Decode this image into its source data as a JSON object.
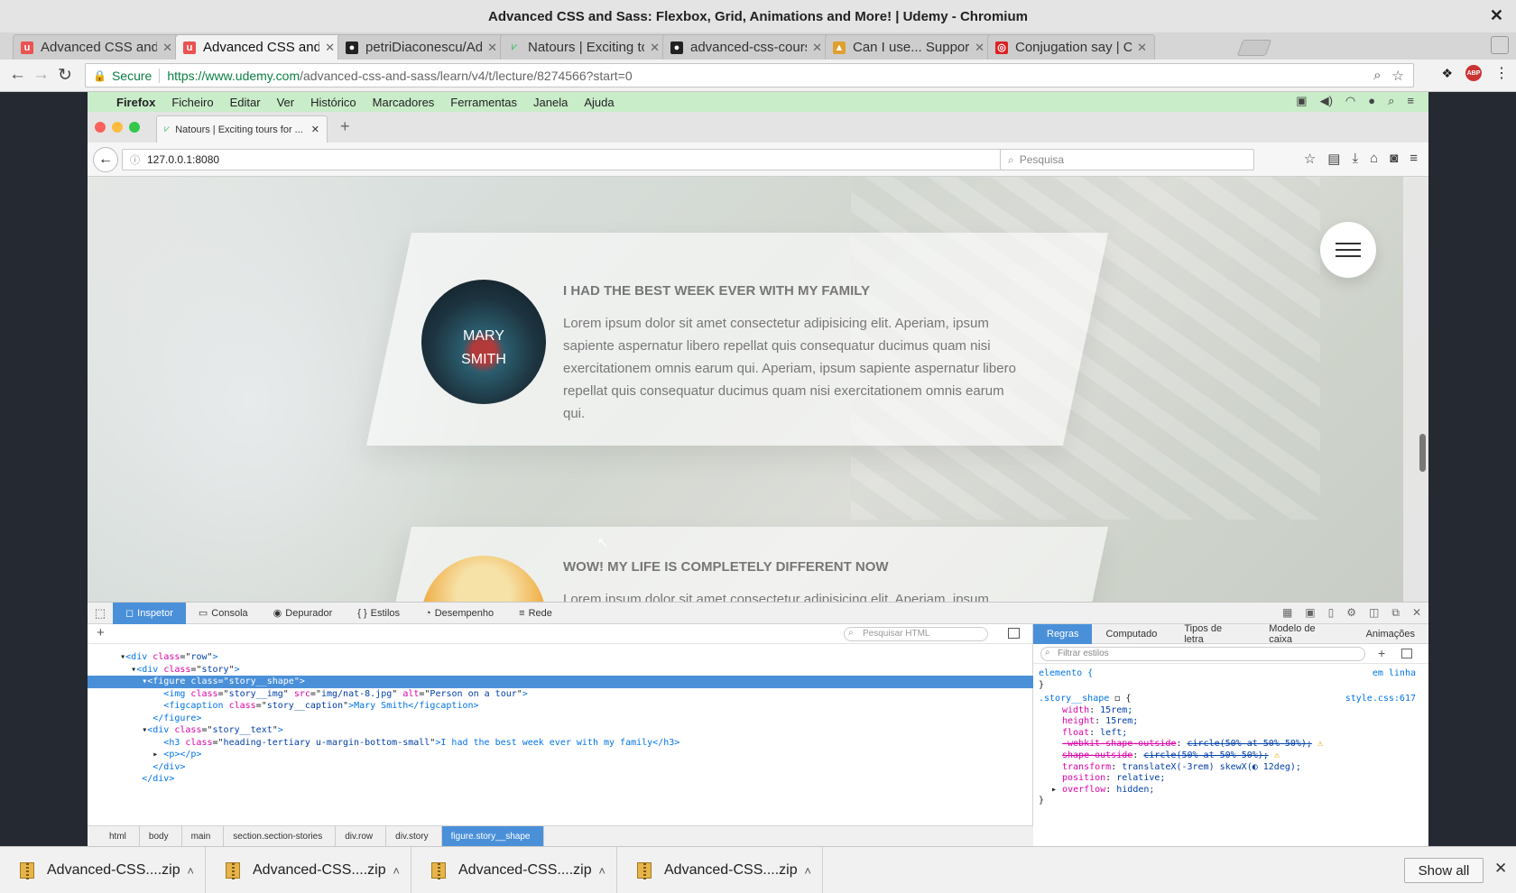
{
  "window": {
    "title": "Advanced CSS and Sass: Flexbox, Grid, Animations and More! | Udemy - Chromium"
  },
  "tabs": [
    {
      "title": "Advanced CSS and S",
      "favicon": "udemy",
      "active": false
    },
    {
      "title": "Advanced CSS and S",
      "favicon": "udemy",
      "active": true
    },
    {
      "title": "petriDiaconescu/Adv",
      "favicon": "github",
      "active": false
    },
    {
      "title": "Natours | Exciting to",
      "favicon": "natours",
      "active": false
    },
    {
      "title": "advanced-css-cours",
      "favicon": "github",
      "active": false
    },
    {
      "title": "Can I use... Support",
      "favicon": "caniuse",
      "active": false
    },
    {
      "title": "Conjugation say | C",
      "favicon": "reverso",
      "active": false
    }
  ],
  "omnibox": {
    "secure_label": "Secure",
    "url_host": "https://www.udemy.com",
    "url_path": "/advanced-css-and-sass/learn/v4/t/lecture/8274566?start=0"
  },
  "mac": {
    "menu": [
      "Firefox",
      "Ficheiro",
      "Editar",
      "Ver",
      "Histórico",
      "Marcadores",
      "Ferramentas",
      "Janela",
      "Ajuda"
    ]
  },
  "firefox": {
    "tab_title": "Natours | Exciting tours for ...",
    "url": "127.0.0.1:8080",
    "search_placeholder": "Pesquisa"
  },
  "stories": [
    {
      "caption_line1": "Mary",
      "caption_line2": "Smith",
      "title": "I had the best week ever with my family",
      "text": "Lorem ipsum dolor sit amet consectetur adipisicing elit. Aperiam, ipsum sapiente aspernatur libero repellat quis consequatur ducimus quam nisi exercitationem omnis earum qui. Aperiam, ipsum sapiente aspernatur libero repellat quis consequatur ducimus quam nisi exercitationem omnis earum qui."
    },
    {
      "title": "WOW! My life is completely different now",
      "text": "Lorem ipsum dolor sit amet consectetur adipisicing elit. Aperiam, ipsum"
    }
  ],
  "devtools": {
    "tabs": [
      "Inspetor",
      "Consola",
      "Depurador",
      "Estilos",
      "Desempenho",
      "Rede"
    ],
    "html_search_placeholder": "Pesquisar HTML",
    "markup": [
      {
        "indent": "  ▾",
        "tag": "div",
        "attrs": [
          [
            "class",
            "row"
          ]
        ],
        "after": ">"
      },
      {
        "indent": "    ▾",
        "tag": "div",
        "attrs": [
          [
            "class",
            "story"
          ]
        ],
        "after": ">"
      },
      {
        "indent": "      ▾",
        "tag": "figure",
        "attrs": [
          [
            "class",
            "story__shape"
          ]
        ],
        "after": ">",
        "selected": true
      },
      {
        "indent": "          ",
        "tag": "img",
        "attrs": [
          [
            "class",
            "story__img"
          ],
          [
            "src",
            "img/nat-8.jpg"
          ],
          [
            "alt",
            "Person on a tour"
          ]
        ],
        "after": ">"
      },
      {
        "indent": "          ",
        "tag": "figcaption",
        "attrs": [
          [
            "class",
            "story__caption"
          ]
        ],
        "after": ">Mary Smith</figcaption>"
      },
      {
        "indent": "        ",
        "raw": "</figure>"
      },
      {
        "indent": "      ▾",
        "tag": "div",
        "attrs": [
          [
            "class",
            "story__text"
          ]
        ],
        "after": ">"
      },
      {
        "indent": "          ",
        "tag": "h3",
        "attrs": [
          [
            "class",
            "heading-tertiary u-margin-bottom-small"
          ]
        ],
        "after": ">I had the best week ever with my family</h3>"
      },
      {
        "indent": "        ▸ ",
        "raw": "<p></p>"
      },
      {
        "indent": "        ",
        "raw": "</div>"
      },
      {
        "indent": "      ",
        "raw": "</div>"
      }
    ],
    "breadcrumbs": [
      "html",
      "body",
      "main",
      "section.section-stories",
      "div.row",
      "div.story",
      "figure.story__shape"
    ],
    "rules_tabs": [
      "Regras",
      "Computado",
      "Tipos de letra",
      "Modelo de caixa",
      "Animações"
    ],
    "filter_placeholder": "Filtrar estilos",
    "element_rule": {
      "selector": "elemento {",
      "source": "em linha"
    },
    "shape_rule": {
      "selector": ".story__shape",
      "source": "style.css:617",
      "declarations": [
        {
          "prop": "width",
          "value": "15rem;",
          "struck": false,
          "warn": false
        },
        {
          "prop": "height",
          "value": "15rem;",
          "struck": false,
          "warn": false
        },
        {
          "prop": "float",
          "value": "left;",
          "struck": false,
          "warn": false
        },
        {
          "prop": "-webkit-shape-outside",
          "value": "circle(50% at 50% 50%);",
          "struck": true,
          "warn": true
        },
        {
          "prop": "shape-outside",
          "value": "circle(50% at 50% 50%);",
          "struck": true,
          "warn": true
        },
        {
          "prop": "transform",
          "value": "translateX(-3rem) skewX(◐ 12deg);",
          "struck": false,
          "warn": false
        },
        {
          "prop": "position",
          "value": "relative;",
          "struck": false,
          "warn": false
        },
        {
          "prop": "overflow",
          "value": "hidden;",
          "struck": false,
          "warn": false
        }
      ]
    }
  },
  "downloads": {
    "items": [
      "Advanced-CSS....zip",
      "Advanced-CSS....zip",
      "Advanced-CSS....zip",
      "Advanced-CSS....zip"
    ],
    "show_all": "Show all"
  },
  "colors": {
    "selection": "#4a90d9",
    "secure": "#0b8043",
    "mac_menubar": "#c9ecc9"
  }
}
